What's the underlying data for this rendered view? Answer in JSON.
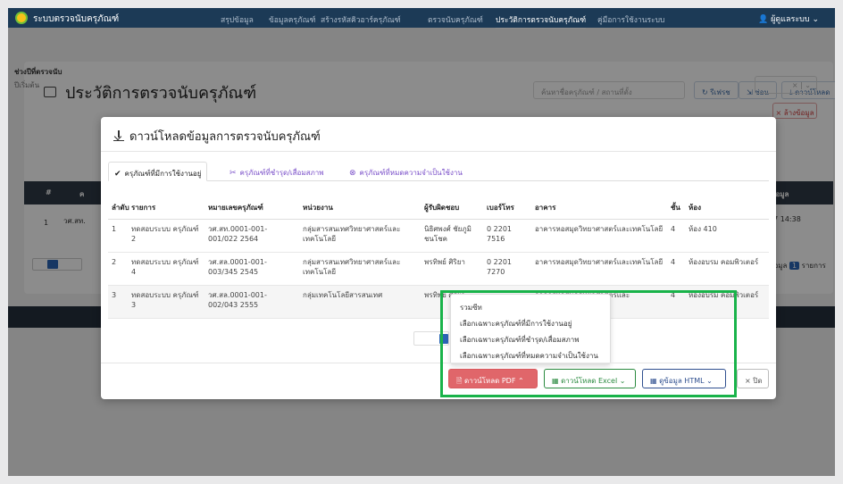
{
  "navbar": {
    "brand": "ระบบตรวจนับครุภัณฑ์",
    "items": [
      "สรุปข้อมูล",
      "ข้อมูลครุภัณฑ์",
      "สร้างรหัสคิวอาร์ครุภัณฑ์",
      "ตรวจนับครุภัณฑ์",
      "ประวัติการตรวจนับครุภัณฑ์",
      "คู่มือการใช้งานระบบ"
    ],
    "active_index": 4,
    "user": "ผู้ดูแลระบบ ⌄"
  },
  "background_page": {
    "title": "ประวัติการตรวจนับครุภัณฑ์",
    "search_placeholder": "ค้นหาชื่อครุภัณฑ์ / สถานที่ตั้ง",
    "refresh_label": "↻ รีเฟรช",
    "hide_label": "ซ่อน",
    "download_label": "⤓ ดาวน์โหลด",
    "period_label": "ช่วงปีที่ตรวจนับ",
    "period_value": "ปีเริ่มต้น",
    "select_clear": "× | ⌄",
    "clear_data_label": "× ล้างข้อมูล",
    "table_header_num": "#",
    "table_header_k": "ค",
    "table_header_right": "ข้อมูล",
    "row_num": "1",
    "row_code": "วศ.สท.",
    "row_time": "57 14:38",
    "row_dot": ".",
    "pager_text": "ข้อมูล",
    "pager_count": "1",
    "pager_suffix": "รายการ"
  },
  "modal": {
    "title": "ดาวน์โหลดข้อมูลการตรวจนับครุภัณฑ์",
    "tabs": [
      {
        "icon": "✔",
        "label": "ครุภัณฑ์ที่มีการใช้งานอยู่"
      },
      {
        "icon": "✂",
        "label": "ครุภัณฑ์ที่ชำรุด/เสื่อมสภาพ"
      },
      {
        "icon": "⊗",
        "label": "ครุภัณฑ์ที่หมดความจำเป็นใช้งาน"
      }
    ],
    "columns": [
      "ลำดับ",
      "รายการ",
      "หมายเลขครุภัณฑ์",
      "หน่วยงาน",
      "ผู้รับผิดชอบ",
      "เบอร์โทร",
      "อาคาร",
      "ชั้น",
      "ห้อง"
    ],
    "rows": [
      [
        "1",
        "ทดสอบระบบ ครุภัณฑ์ 2",
        "วศ.สท.0001-001-001/022 2564",
        "กลุ่มสารสนเทศวิทยาศาสตร์และเทคโนโลยี",
        "นิธิศพงศ์ ชัยภูมิชนโชค",
        "0 2201 7516",
        "อาคารหอสมุดวิทยาศาสตร์และเทคโนโลยี",
        "4",
        "ห้อง 410"
      ],
      [
        "2",
        "ทดสอบระบบ ครุภัณฑ์ 4",
        "วศ.สล.0001-001-003/345 2545",
        "กลุ่มสารสนเทศวิทยาศาสตร์และเทคโนโลยี",
        "พรทิพย์ ศิริยา",
        "0 2201 7270",
        "อาคารหอสมุดวิทยาศาสตร์และเทคโนโลยี",
        "4",
        "ห้องอบรม คอมพิวเตอร์"
      ],
      [
        "3",
        "ทดสอบระบบ ครุภัณฑ์ 3",
        "วศ.สล.0001-001-002/043 2555",
        "กลุ่มเทคโนโลยีสารสนเทศ",
        "พรทิพย์ ศิริยา",
        "",
        "อาคารหอสมุดวิทยาศาสตร์และ",
        "4",
        "ห้องอบรม คอมพิวเตอร์"
      ]
    ],
    "dropdown_items": [
      "รวมซีท",
      "เลือกเฉพาะครุภัณฑ์ที่มีการใช้งานอยู่",
      "เลือกเฉพาะครุภัณฑ์ที่ชำรุด/เสื่อมสภาพ",
      "เลือกเฉพาะครุภัณฑ์ที่หมดความจำเป็นใช้งาน"
    ],
    "buttons": {
      "pdf": "ดาวน์โหลด PDF ⌃",
      "excel": "ดาวน์โหลด Excel ⌄",
      "html": "ดูข้อมูล HTML ⌄",
      "close": "× ปิด"
    }
  },
  "colors": {
    "navbar": "#1c3a56",
    "pdf_button": "#e0666a",
    "excel_button": "#2a8a3f",
    "html_button": "#2f4f8f",
    "highlight": "#19b34a"
  }
}
